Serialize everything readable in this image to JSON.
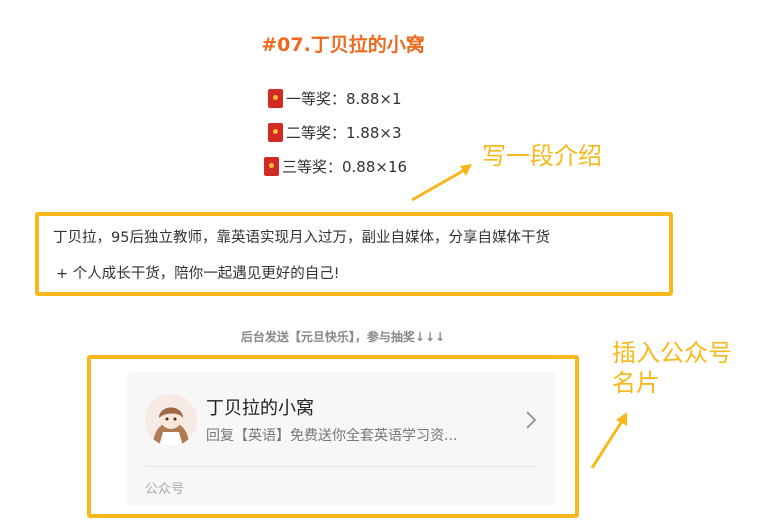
{
  "title": "#07.丁贝拉的小窝",
  "prizes": [
    {
      "icon": "red-envelope-icon",
      "label": "一等奖：8.88×1"
    },
    {
      "icon": "red-envelope-icon",
      "label": "二等奖：1.88×3"
    },
    {
      "icon": "red-envelope-icon",
      "label": "三等奖：0.88×16"
    }
  ],
  "intro": {
    "line1": "丁贝拉，95后独立教师，靠英语实现月入过万，副业自媒体，分享自媒体干货",
    "line2": "+ 个人成长干货，陪你一起遇见更好的自己!"
  },
  "annotations": {
    "intro_note": "写一段介绍",
    "card_note_line1": "插入公众号",
    "card_note_line2": "名片"
  },
  "hint": "后台发送【元旦快乐】，参与抽奖↓↓↓",
  "account_card": {
    "name": "丁贝拉的小窝",
    "description": "回复【英语】免费送你全套英语学习资...",
    "type_label": "公众号"
  },
  "colors": {
    "title": "#ee6a1e",
    "highlight": "#f8b81b",
    "envelope": "#d22b25"
  }
}
